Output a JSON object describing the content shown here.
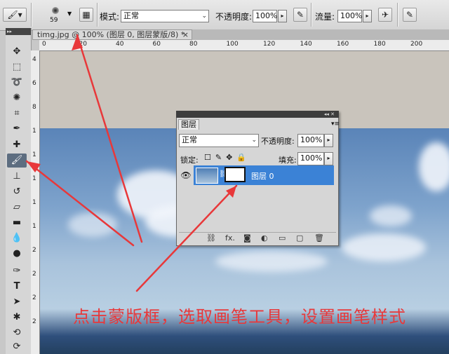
{
  "options_bar": {
    "brush_size": "59",
    "mode_label": "模式:",
    "mode_value": "正常",
    "opacity_label": "不透明度:",
    "opacity_value": "100%",
    "flow_label": "流量:",
    "flow_value": "100%"
  },
  "document": {
    "tab_title": "timg.jpg @ 100% (图层 0, 图层蒙版/8) *",
    "tab_close": "×"
  },
  "ruler": {
    "h_ticks": [
      "0",
      "20",
      "40",
      "60",
      "80",
      "100",
      "120",
      "140",
      "160",
      "180",
      "200"
    ],
    "v_ticks": [
      "4",
      "6",
      "8",
      "1",
      "1",
      "1",
      "1",
      "1",
      "2",
      "2",
      "2",
      "2"
    ]
  },
  "layers_panel": {
    "tab": "图层",
    "blend_mode": "正常",
    "opacity_label": "不透明度:",
    "opacity_value": "100%",
    "lock_label": "锁定:",
    "fill_label": "填充:",
    "fill_value": "100%",
    "layer_name": "图层 0",
    "fx_label": "fx."
  },
  "annotation": {
    "text": "点击蒙版框，选取画笔工具，设置画笔样式",
    "color": "#e8383a"
  },
  "icons": [
    "brush-icon",
    "airbrush-icon",
    "move-icon",
    "marquee-icon",
    "lasso-icon",
    "quick-select-icon",
    "crop-icon",
    "eyedropper-icon",
    "healing-icon",
    "brush-tool-icon",
    "stamp-icon",
    "history-brush-icon",
    "eraser-icon",
    "gradient-icon",
    "blur-icon",
    "dodge-icon",
    "pen-icon",
    "type-icon",
    "path-select-icon",
    "shape-icon",
    "3d-icon",
    "eye-icon",
    "link-icon",
    "lock-icon",
    "trash-icon"
  ],
  "colors": {
    "selection": "#3b82d6",
    "arrow": "#e8383a",
    "sky": "#7ea3cc"
  }
}
